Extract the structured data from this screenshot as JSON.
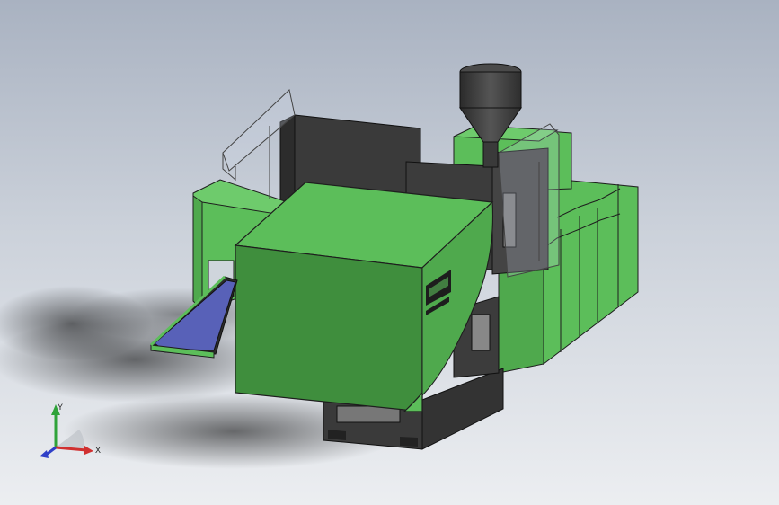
{
  "viewport": {
    "background_top": "#a9b2c1",
    "background_bottom": "#eceef1"
  },
  "model": {
    "subject": "injection-molding-machine",
    "body_color": "#5cbe5a",
    "body_dark": "#3f8e3d",
    "frame_color": "#3a3a3a",
    "hopper_color": "#3d3d3d",
    "conveyor_belt_color": "#5861b8",
    "logo_text": "",
    "logo_subtext": ""
  },
  "triad": {
    "x_label": "X",
    "y_label": "Y",
    "x_color": "#d03030",
    "y_color": "#2fa33a",
    "z_color": "#2f3fc8"
  }
}
